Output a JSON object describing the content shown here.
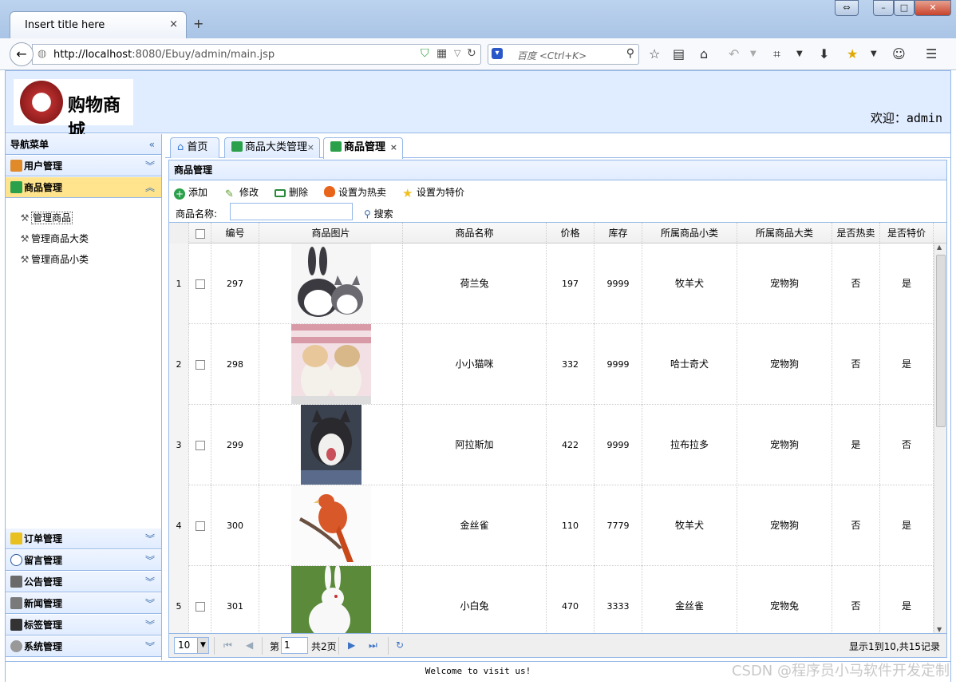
{
  "browser": {
    "tab_title": "Insert title here",
    "tab_close": "×",
    "new_tab": "+",
    "url_host": "http://localhost",
    "url_path": ":8080/Ebuy/admin/main.jsp",
    "search_placeholder": "百度 <Ctrl+K>"
  },
  "header": {
    "logo_text": "购物商城",
    "welcome": "欢迎：admin"
  },
  "sidebar": {
    "title": "导航菜单",
    "panels_top": [
      {
        "label": "用户管理",
        "color": "#e08a2a"
      },
      {
        "label": "商品管理",
        "color": "#2aa04a"
      }
    ],
    "tree": [
      "管理商品",
      "管理商品大类",
      "管理商品小类"
    ],
    "panels_bottom": [
      {
        "label": "订单管理",
        "color": "#e8c020"
      },
      {
        "label": "留言管理",
        "color": "#2a5a9a"
      },
      {
        "label": "公告管理",
        "color": "#6a6a6a"
      },
      {
        "label": "新闻管理",
        "color": "#7a7a7a"
      },
      {
        "label": "标签管理",
        "color": "#333333"
      },
      {
        "label": "系统管理",
        "color": "#999999"
      }
    ]
  },
  "tabs": [
    {
      "label": "首页",
      "closable": false
    },
    {
      "label": "商品大类管理",
      "closable": true
    },
    {
      "label": "商品管理",
      "closable": true,
      "active": true
    }
  ],
  "panel_title": "商品管理",
  "toolbar": {
    "add": "添加",
    "edit": "修改",
    "delete": "删除",
    "set_hot": "设置为热卖",
    "set_special": "设置为特价",
    "name_label": "商品名称:",
    "search": "搜索"
  },
  "grid": {
    "columns": [
      "编号",
      "商品图片",
      "商品名称",
      "价格",
      "库存",
      "所属商品小类",
      "所属商品大类",
      "是否热卖",
      "是否特价"
    ],
    "rows": [
      {
        "n": "1",
        "id": "297",
        "image": "rabbit-and-kitten-photo",
        "name": "荷兰兔",
        "price": "197",
        "stock": "9999",
        "sub": "牧羊犬",
        "big": "宠物狗",
        "hot": "否",
        "special": "是"
      },
      {
        "n": "2",
        "id": "298",
        "image": "two-kittens-photo",
        "name": "小小猫咪",
        "price": "332",
        "stock": "9999",
        "sub": "哈士奇犬",
        "big": "宠物狗",
        "hot": "否",
        "special": "是"
      },
      {
        "n": "3",
        "id": "299",
        "image": "husky-puppy-photo",
        "name": "阿拉斯加",
        "price": "422",
        "stock": "9999",
        "sub": "拉布拉多",
        "big": "宠物狗",
        "hot": "是",
        "special": "否"
      },
      {
        "n": "4",
        "id": "300",
        "image": "canary-bird-photo",
        "name": "金丝雀",
        "price": "110",
        "stock": "7779",
        "sub": "牧羊犬",
        "big": "宠物狗",
        "hot": "否",
        "special": "是"
      },
      {
        "n": "5",
        "id": "301",
        "image": "white-rabbit-photo",
        "name": "小白兔",
        "price": "470",
        "stock": "3333",
        "sub": "金丝雀",
        "big": "宠物兔",
        "hot": "否",
        "special": "是"
      }
    ]
  },
  "pager": {
    "page_size": "10",
    "page_prefix": "第",
    "page_value": "1",
    "page_suffix": "共2页",
    "summary": "显示1到10,共15记录"
  },
  "footer": "Welcome to visit us!",
  "watermark": "CSDN @程序员小马软件开发定制"
}
